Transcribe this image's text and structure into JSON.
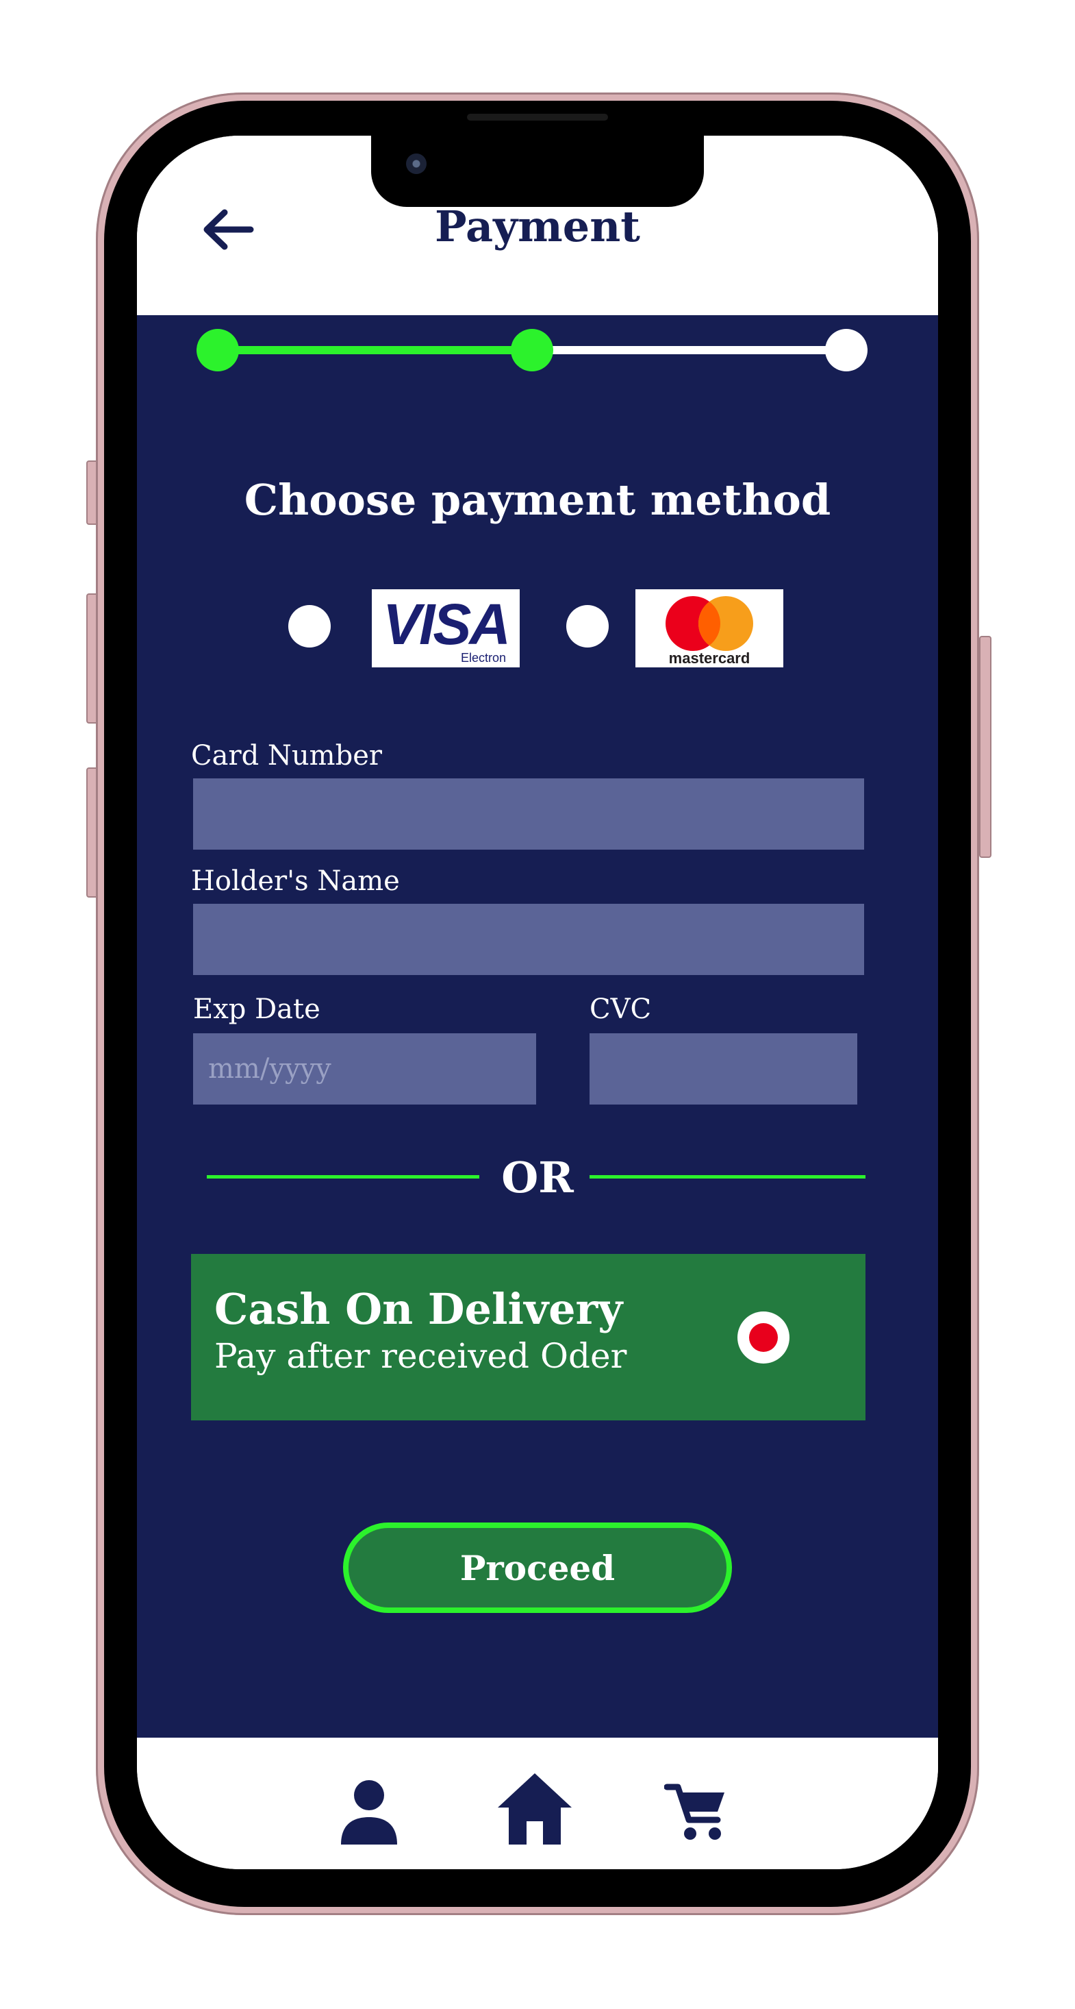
{
  "header": {
    "back_icon": "arrow-left-icon",
    "title": "Payment"
  },
  "progress": {
    "total_steps": 3,
    "completed_steps": 2,
    "active_color": "#2cf22c",
    "inactive_color": "#ffffff"
  },
  "payment_method": {
    "title": "Choose payment method",
    "options": [
      {
        "name": "VISA",
        "sub": "Electron",
        "selected": false
      },
      {
        "name": "mastercard",
        "selected": false
      }
    ]
  },
  "form": {
    "card_number": {
      "label": "Card Number",
      "value": ""
    },
    "holder_name": {
      "label": "Holder's Name",
      "value": ""
    },
    "exp_date": {
      "label": "Exp Date",
      "placeholder": "mm/yyyy",
      "value": ""
    },
    "cvc": {
      "label": "CVC",
      "value": ""
    }
  },
  "divider": {
    "text": "OR"
  },
  "cash_on_delivery": {
    "title": "Cash On Delivery",
    "subtitle": "Pay after received Oder",
    "selected": true
  },
  "proceed_label": "Proceed",
  "bottom_nav": [
    {
      "name": "profile",
      "icon": "person-icon"
    },
    {
      "name": "home",
      "icon": "home-icon"
    },
    {
      "name": "cart",
      "icon": "cart-icon"
    }
  ],
  "colors": {
    "primary": "#161e53",
    "accent_green": "#2cf22c",
    "cod_green": "#237b3f",
    "input_bg": "#5b6497",
    "radio_selected": "#e8001c"
  }
}
